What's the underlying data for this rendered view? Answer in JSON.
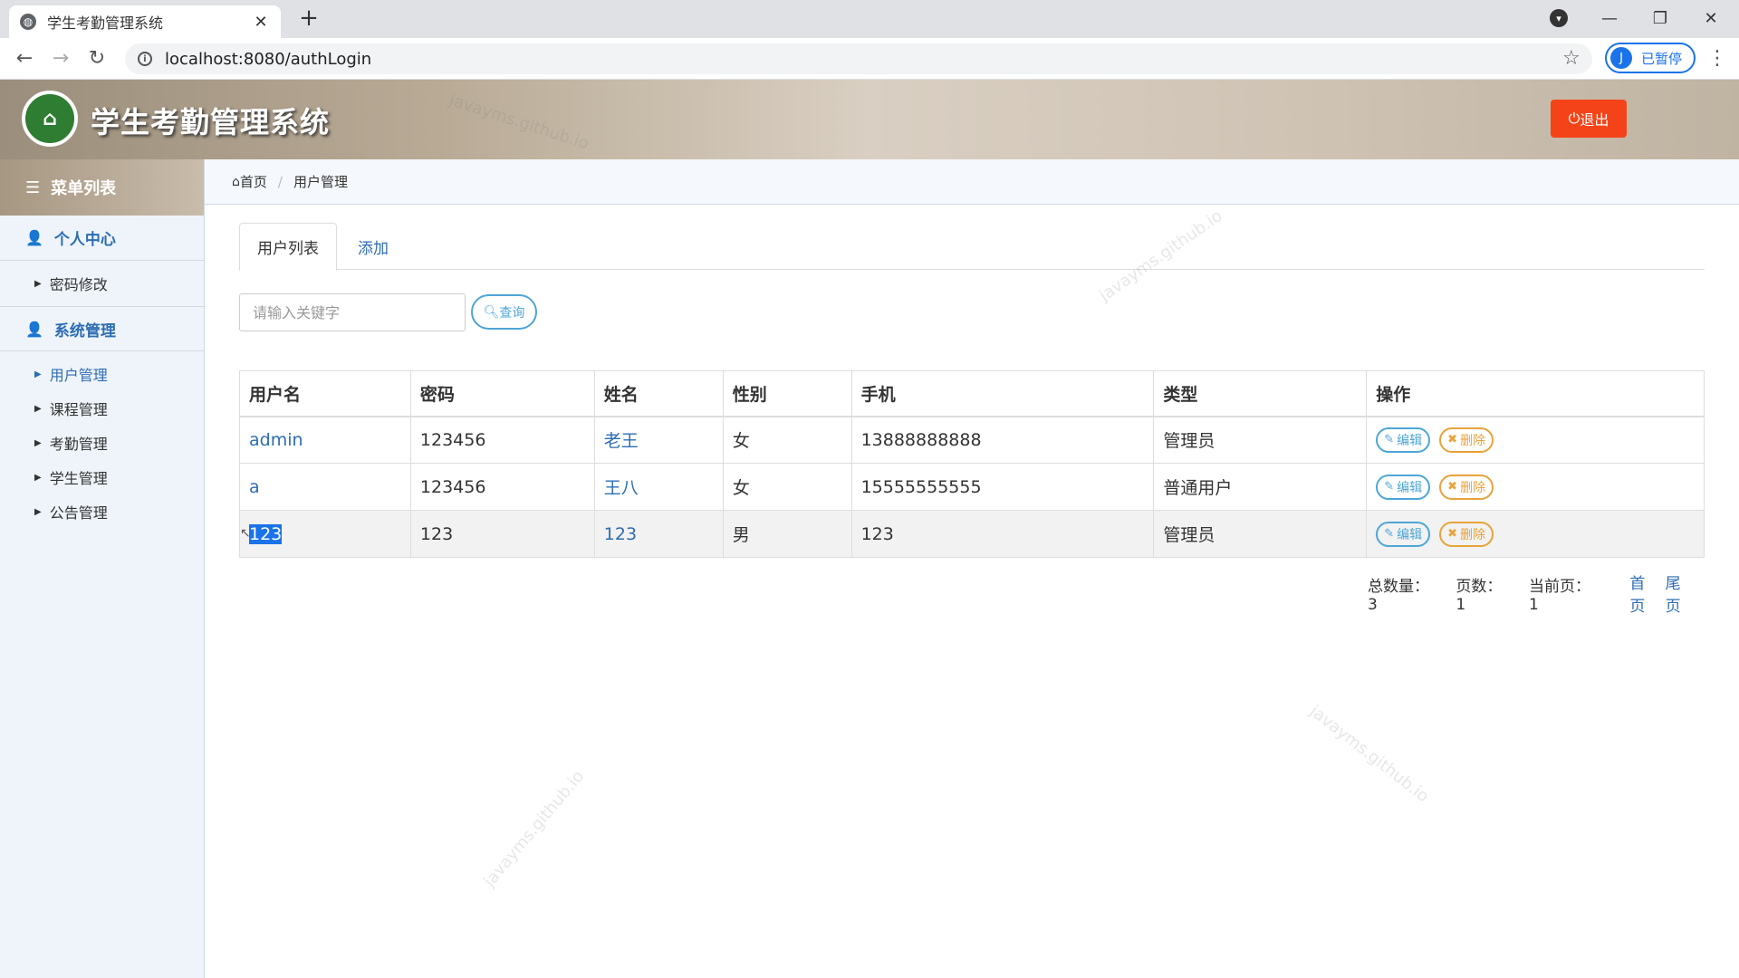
{
  "browser": {
    "tab_title": "学生考勤管理系统",
    "url": "localhost:8080/authLogin",
    "profile_initial": "J",
    "profile_status": "已暂停"
  },
  "header": {
    "title": "学生考勤管理系统",
    "logout_label": "退出"
  },
  "sidebar": {
    "menu_title": "菜单列表",
    "groups": [
      {
        "label": "个人中心",
        "items": [
          {
            "label": "密码修改"
          }
        ]
      },
      {
        "label": "系统管理",
        "items": [
          {
            "label": "用户管理"
          },
          {
            "label": "课程管理"
          },
          {
            "label": "考勤管理"
          },
          {
            "label": "学生管理"
          },
          {
            "label": "公告管理"
          }
        ]
      }
    ]
  },
  "breadcrumb": {
    "home": "首页",
    "current": "用户管理"
  },
  "tabs": [
    {
      "label": "用户列表"
    },
    {
      "label": "添加"
    }
  ],
  "search": {
    "placeholder": "请输入关键字",
    "button_label": "查询"
  },
  "table": {
    "headers": [
      "用户名",
      "密码",
      "姓名",
      "性别",
      "手机",
      "类型",
      "操作"
    ],
    "rows": [
      {
        "username": "admin",
        "password": "123456",
        "name": "老王",
        "gender": "女",
        "phone": "13888888888",
        "type": "管理员"
      },
      {
        "username": "a",
        "password": "123456",
        "name": "王八",
        "gender": "女",
        "phone": "15555555555",
        "type": "普通用户"
      },
      {
        "username": "123",
        "password": "123",
        "name": "123",
        "gender": "男",
        "phone": "123",
        "type": "管理员"
      }
    ],
    "edit_label": "编辑",
    "delete_label": "删除"
  },
  "pager": {
    "total_label": "总数量：3",
    "pages_label": "页数：1",
    "current_label": "当前页：1",
    "first_label": "首页",
    "last_label": "尾页"
  },
  "watermark": "javayms.github.io",
  "colors": {
    "accent": "#2d6db3",
    "logout": "#f44318",
    "edit": "#4da6d6",
    "delete": "#e8a33b"
  }
}
